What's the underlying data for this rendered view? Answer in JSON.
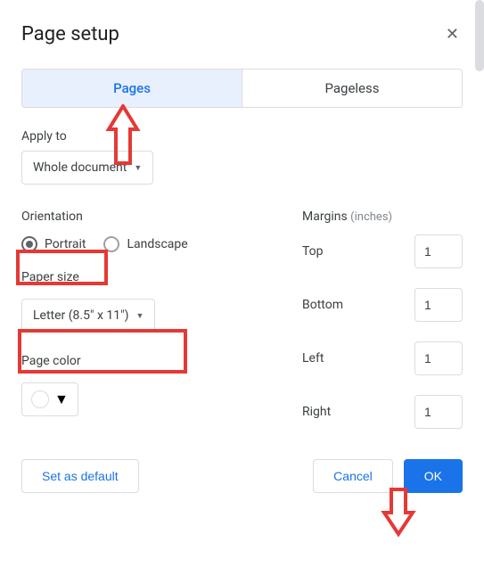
{
  "dialog": {
    "title": "Page setup"
  },
  "tabs": {
    "pages": "Pages",
    "pageless": "Pageless"
  },
  "applyTo": {
    "label": "Apply to",
    "value": "Whole document"
  },
  "orientation": {
    "label": "Orientation",
    "portrait": "Portrait",
    "landscape": "Landscape"
  },
  "paperSize": {
    "label": "Paper size",
    "value": "Letter (8.5\" x 11\")"
  },
  "pageColor": {
    "label": "Page color"
  },
  "margins": {
    "label": "Margins",
    "unit": "(inches)",
    "top": {
      "label": "Top",
      "value": "1"
    },
    "bottom": {
      "label": "Bottom",
      "value": "1"
    },
    "left": {
      "label": "Left",
      "value": "1"
    },
    "right": {
      "label": "Right",
      "value": "1"
    }
  },
  "buttons": {
    "setDefault": "Set as default",
    "cancel": "Cancel",
    "ok": "OK"
  }
}
